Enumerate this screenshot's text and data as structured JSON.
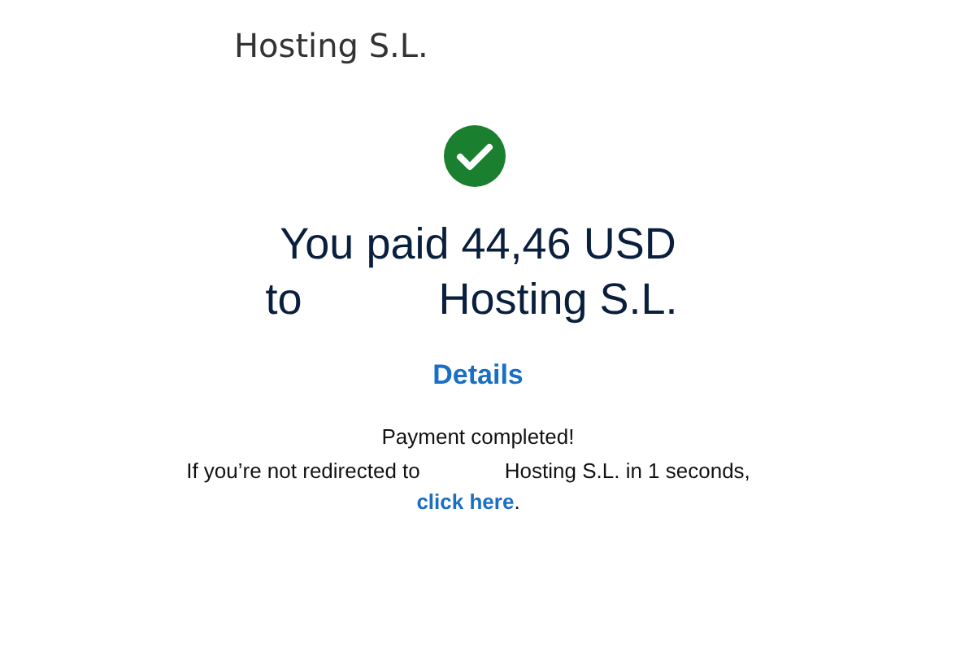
{
  "header": {
    "title": "Hosting S.L."
  },
  "status": {
    "kind": "success"
  },
  "headline": {
    "line_1": "You paid 44,46 USD",
    "line_2_start": "to",
    "line_2_end": "Hosting S.L."
  },
  "details_link": "Details",
  "message": {
    "title": "Payment completed!",
    "text_before": "If you’re not redirected to",
    "text_after": "Hosting S.L. in 1 seconds,",
    "link": "click here",
    "end": "."
  }
}
